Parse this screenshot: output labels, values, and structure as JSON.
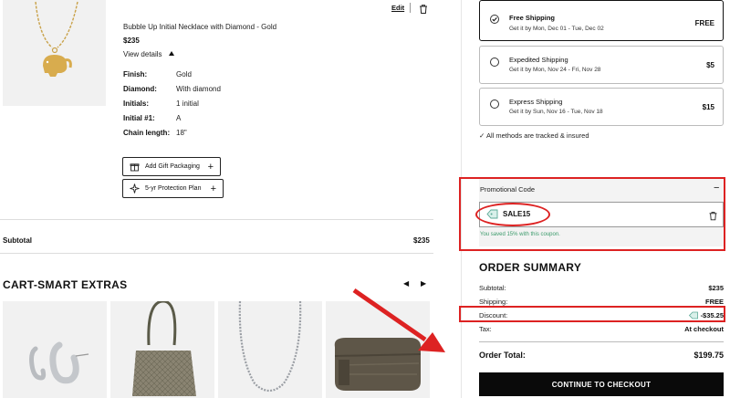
{
  "product": {
    "title": "Bubble Up Initial Necklace with Diamond - Gold",
    "price": "$235",
    "view_details": "View details",
    "edit": "Edit",
    "specs": [
      {
        "label": "Finish:",
        "value": "Gold"
      },
      {
        "label": "Diamond:",
        "value": "With diamond"
      },
      {
        "label": "Initials:",
        "value": "1 initial"
      },
      {
        "label": "Initial #1:",
        "value": "A"
      },
      {
        "label": "Chain length:",
        "value": "18\""
      }
    ],
    "add_gift_label": "Add Gift Packaging",
    "protection_label": "5-yr Protection Plan"
  },
  "cart": {
    "subtotal_label": "Subtotal",
    "subtotal_value": "$235"
  },
  "extras": {
    "title": "CART-SMART EXTRAS",
    "prev": "◀",
    "next": "▶"
  },
  "shipping": {
    "options": [
      {
        "name": "Free Shipping",
        "eta": "Get it by Mon, Dec 01 - Tue, Dec 02",
        "price": "FREE",
        "selected": true
      },
      {
        "name": "Expedited Shipping",
        "eta": "Get it by Mon, Nov 24 - Fri, Nov 28",
        "price": "$5",
        "selected": false
      },
      {
        "name": "Express Shipping",
        "eta": "Get it by Sun, Nov 16 - Tue, Nov 18",
        "price": "$15",
        "selected": false
      }
    ],
    "tracked_note": "✓ All methods are tracked & insured"
  },
  "promo": {
    "label": "Promotional Code",
    "collapse": "−",
    "code": "SALE15",
    "saved_msg": "You saved 15% with this coupon."
  },
  "summary": {
    "title": "ORDER SUMMARY",
    "subtotal_label": "Subtotal:",
    "subtotal_value": "$235",
    "shipping_label": "Shipping:",
    "shipping_value": "FREE",
    "discount_label": "Discount:",
    "discount_value": "-$35.25",
    "tax_label": "Tax:",
    "tax_value": "At checkout",
    "total_label": "Order Total:",
    "total_value": "$199.75",
    "checkout": "CONTINUE TO CHECKOUT"
  },
  "colors": {
    "annotation_red": "#dd2222",
    "button_black": "#0a0a0a",
    "success_green": "#3a9a6a"
  }
}
